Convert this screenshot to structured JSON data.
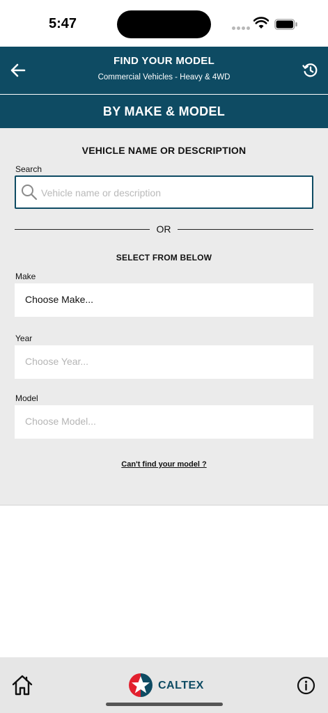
{
  "status_bar": {
    "time": "5:47"
  },
  "header": {
    "title": "FIND YOUR MODEL",
    "subtitle": "Commercial Vehicles - Heavy & 4WD"
  },
  "tab": {
    "label": "BY MAKE & MODEL"
  },
  "form": {
    "section_title": "VEHICLE NAME OR DESCRIPTION",
    "search_label": "Search",
    "search_placeholder": "Vehicle name or description",
    "or_text": "OR",
    "select_title": "SELECT FROM BELOW",
    "make_label": "Make",
    "make_value": "Choose Make...",
    "year_label": "Year",
    "year_value": "Choose Year...",
    "model_label": "Model",
    "model_value": "Choose Model...",
    "help_link": "Can't find your model ?"
  },
  "bottom_bar": {
    "brand": "CALTEX",
    "brand_colors": {
      "teal": "#0e4b63",
      "red": "#e2202e"
    }
  },
  "theme": {
    "primary": "#0e4b63",
    "panel_bg": "#ebebeb"
  }
}
